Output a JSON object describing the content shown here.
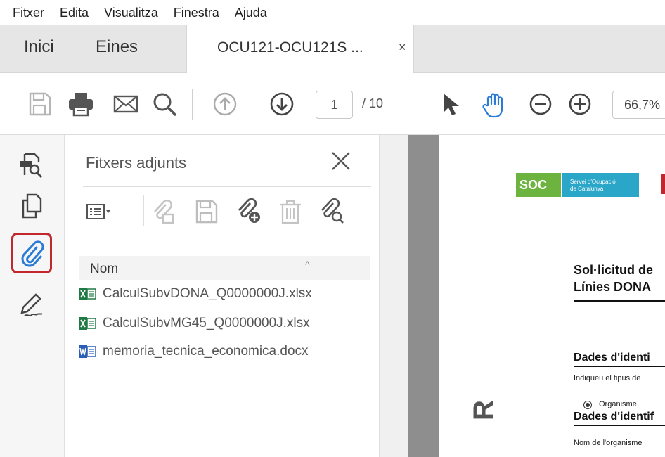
{
  "menubar": {
    "items": [
      "Fitxer",
      "Edita",
      "Visualitza",
      "Finestra",
      "Ajuda"
    ]
  },
  "tabs": {
    "home": "Inici",
    "tools": "Eines",
    "document": "OCU121-OCU121S ...",
    "close": "×"
  },
  "toolbar": {
    "page_current": "1",
    "page_total": "/ 10",
    "zoom": "66,7%",
    "icons": [
      "save-icon",
      "print-icon",
      "email-icon",
      "search-icon",
      "prev-page-icon",
      "next-page-icon",
      "select-cursor-icon",
      "hand-tool-icon",
      "zoom-out-icon",
      "zoom-in-icon"
    ]
  },
  "rail": {
    "icons": [
      "export-pdf-icon",
      "pages-icon",
      "attachments-icon",
      "signature-icon"
    ]
  },
  "panel": {
    "title": "Fitxers adjunts",
    "column_header": "Nom",
    "sort_indicator": "^",
    "files": [
      {
        "name": "CalculSubvDONA_Q0000000J.xlsx",
        "type": "excel"
      },
      {
        "name": "CalculSubvMG45_Q0000000J.xlsx",
        "type": "excel"
      },
      {
        "name": "memoria_tecnica_economica.docx",
        "type": "word"
      }
    ]
  },
  "document": {
    "logo_text": "SOC",
    "logo_subtitle_1": "Servei d'Ocupació",
    "logo_subtitle_2": "de Catalunya",
    "title_line_1": "Sol·licitud de",
    "title_line_2": "Línies DONA",
    "section_1": "Dades d'identi",
    "note_1": "Indiqueu el tipus de",
    "radio_label": "Organisme",
    "section_2": "Dades d'identif",
    "note_2": "Nom de l'organisme",
    "side_letter": "R"
  },
  "colors": {
    "active_highlight": "#c1272d",
    "soc_green": "#6db33f",
    "soc_blue": "#2aa6c8",
    "hand_tool_blue": "#2a7bd6",
    "attachment_blue": "#2a7bd6",
    "excel_green": "#1f7a44",
    "word_blue": "#2b5fb5"
  }
}
